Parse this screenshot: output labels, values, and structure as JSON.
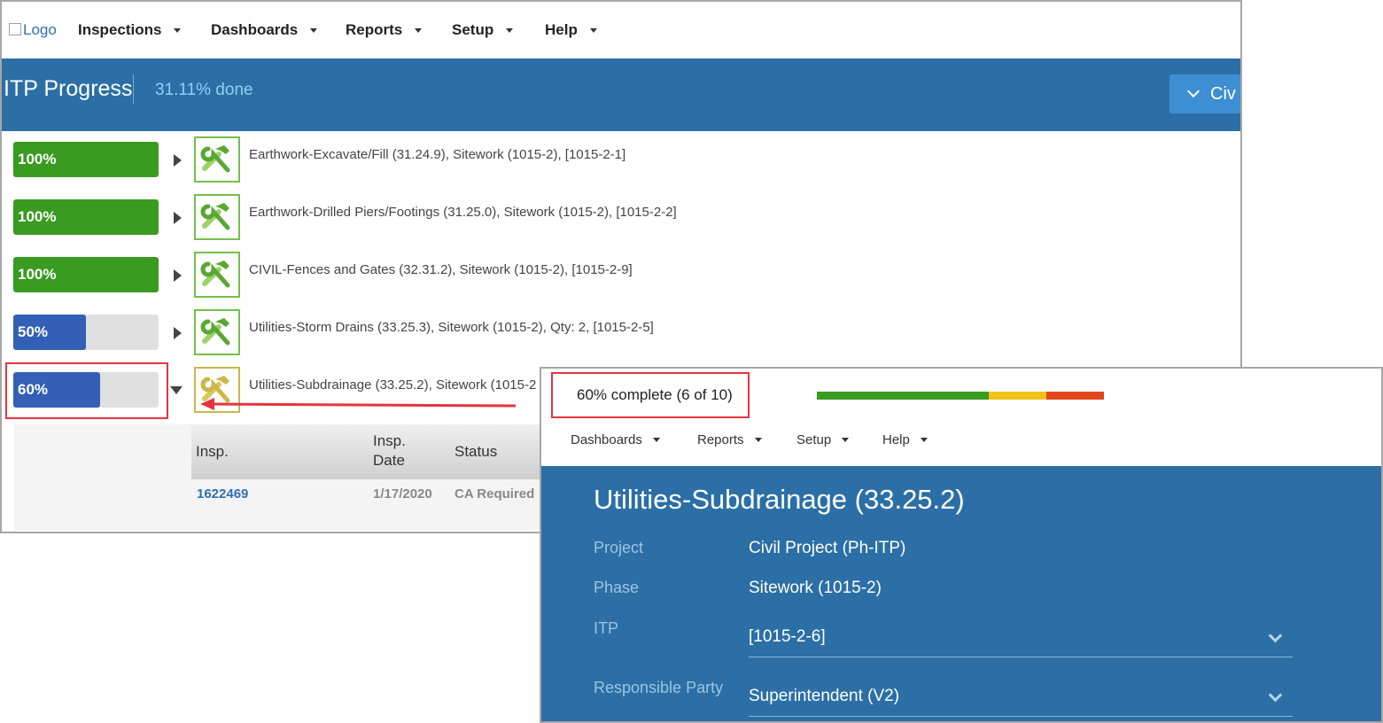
{
  "windowA": {
    "nav": {
      "logo_alt": "Logo",
      "items": [
        {
          "label": "Inspections"
        },
        {
          "label": "Dashboards"
        },
        {
          "label": "Reports"
        },
        {
          "label": "Setup"
        },
        {
          "label": "Help"
        }
      ]
    },
    "header": {
      "title": "ITP Progress",
      "progress_text": "31.11% done",
      "project_button_label": "Civ"
    },
    "rows": [
      {
        "percent": 100,
        "percent_label": "100%",
        "color": "#399b1f",
        "text": "Earthwork-Excavate/Fill (31.24.9), Sitework (1015-2), [1015-2-1]",
        "expanded": false
      },
      {
        "percent": 100,
        "percent_label": "100%",
        "color": "#399b1f",
        "text": "Earthwork-Drilled Piers/Footings (31.25.0), Sitework (1015-2), [1015-2-2]",
        "expanded": false
      },
      {
        "percent": 100,
        "percent_label": "100%",
        "color": "#399b1f",
        "text": "CIVIL-Fences and Gates (32.31.2), Sitework (1015-2), [1015-2-9]",
        "expanded": false
      },
      {
        "percent": 50,
        "percent_label": "50%",
        "color": "#3360b6",
        "text": "Utilities-Storm Drains (33.25.3), Sitework (1015-2), Qty: 2, [1015-2-5]",
        "expanded": false
      },
      {
        "percent": 60,
        "percent_label": "60%",
        "color": "#3360b6",
        "text": "Utilities-Subdrainage (33.25.2), Sitework (1015-2",
        "expanded": true
      }
    ],
    "subtable": {
      "headers": {
        "insp": "Insp.",
        "insp_date": "Insp.\nDate",
        "status": "Status"
      },
      "row": {
        "insp": "1622469",
        "insp_date": "1/17/2020",
        "status": "CA Required"
      }
    }
  },
  "windowB": {
    "completion_text": "60% complete (6 of 10)",
    "status_bar": [
      {
        "fraction": 0.6,
        "color": "#399b1f"
      },
      {
        "fraction": 0.2,
        "color": "#f2c21b"
      },
      {
        "fraction": 0.2,
        "color": "#e2461c"
      }
    ],
    "nav": {
      "items": [
        {
          "label": "Dashboards"
        },
        {
          "label": "Reports"
        },
        {
          "label": "Setup"
        },
        {
          "label": "Help"
        }
      ]
    },
    "title": "Utilities-Subdrainage (33.25.2)",
    "fields": {
      "project_label": "Project",
      "project_value": "Civil Project (Ph-ITP)",
      "phase_label": "Phase",
      "phase_value": "Sitework (1015-2)",
      "itp_label": "ITP",
      "itp_value": "[1015-2-6]",
      "party_label": "Responsible Party",
      "party_value": "Superintendent (V2)"
    }
  },
  "colors": {
    "header_blue": "#2b6fa6",
    "highlight_red": "#e4353e",
    "accent_light_blue": "#8fd0f5"
  }
}
